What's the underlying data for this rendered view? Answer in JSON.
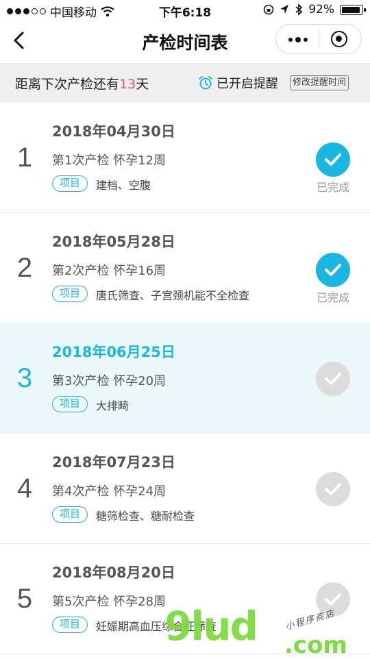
{
  "status_bar": {
    "carrier": "中国移动",
    "time": "下午6:18",
    "battery": "92%",
    "battery_level": 0.92
  },
  "nav": {
    "title": "产检时间表"
  },
  "banner": {
    "countdown_prefix": "距离下次产检还有",
    "countdown_days": "13",
    "countdown_suffix": "天",
    "reminder_status": "已开启提醒",
    "modify_button": "修改提醒时间"
  },
  "checkups": [
    {
      "index": "1",
      "date": "2018年04月30日",
      "title": "第1次产检  怀孕12周",
      "tag": "项目",
      "content": "建档、空腹",
      "completed": true,
      "status_label": "已完成"
    },
    {
      "index": "2",
      "date": "2018年05月28日",
      "title": "第2次产检  怀孕16周",
      "tag": "项目",
      "content": "唐氏筛查、子宫颈机能不全检查",
      "completed": true,
      "status_label": "已完成"
    },
    {
      "index": "3",
      "date": "2018年06月25日",
      "title": "第3次产检  怀孕20周",
      "tag": "项目",
      "content": "大排畸",
      "completed": false,
      "highlighted": true
    },
    {
      "index": "4",
      "date": "2018年07月23日",
      "title": "第4次产检  怀孕24周",
      "tag": "项目",
      "content": "糖筛检查、糖耐检查",
      "completed": false
    },
    {
      "index": "5",
      "date": "2018年08月20日",
      "title": "第5次产检  怀孕28周",
      "tag": "项目",
      "content": "妊娠期高血压综合征筛查",
      "completed": false
    }
  ],
  "watermark": {
    "brand": "9lud",
    "tld": ".com",
    "handwriting": "小程序商店"
  },
  "colors": {
    "accent": "#1bb7e3",
    "countdown_number": "#f0506e",
    "pending_check": "#dcdcdc",
    "highlight_row": "#edf8fb",
    "banner_bg": "#efefef"
  }
}
